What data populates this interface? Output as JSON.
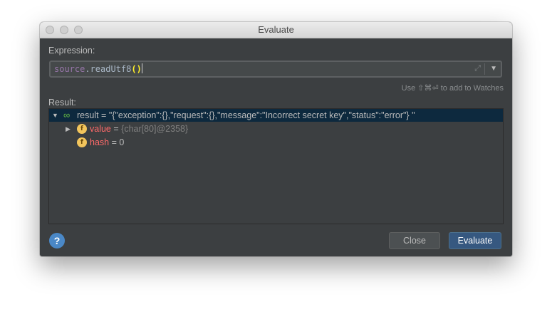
{
  "window": {
    "title": "Evaluate"
  },
  "expression": {
    "label": "Expression:",
    "code_var": "source",
    "code_dot_method": ".readUtf8",
    "code_parens": "()",
    "hint": "Use ⇧⌘⏎ to add to Watches"
  },
  "result": {
    "label": "Result:",
    "rows": [
      {
        "name": "result",
        "eq": " = ",
        "value": "\"{\"exception\":{},\"request\":{},\"message\":\"Incorrect secret key\",\"status\":\"error\"} \""
      },
      {
        "name": "value",
        "eq": " = ",
        "value": "{char[80]@2358}"
      },
      {
        "name": "hash",
        "eq": " = ",
        "value": "0"
      }
    ]
  },
  "icons": {
    "field": "f",
    "help": "?"
  },
  "buttons": {
    "close": "Close",
    "evaluate": "Evaluate"
  },
  "colors": {
    "selection": "#0d293e",
    "primary_button": "#365880",
    "field_name": "#ff6a6a"
  }
}
